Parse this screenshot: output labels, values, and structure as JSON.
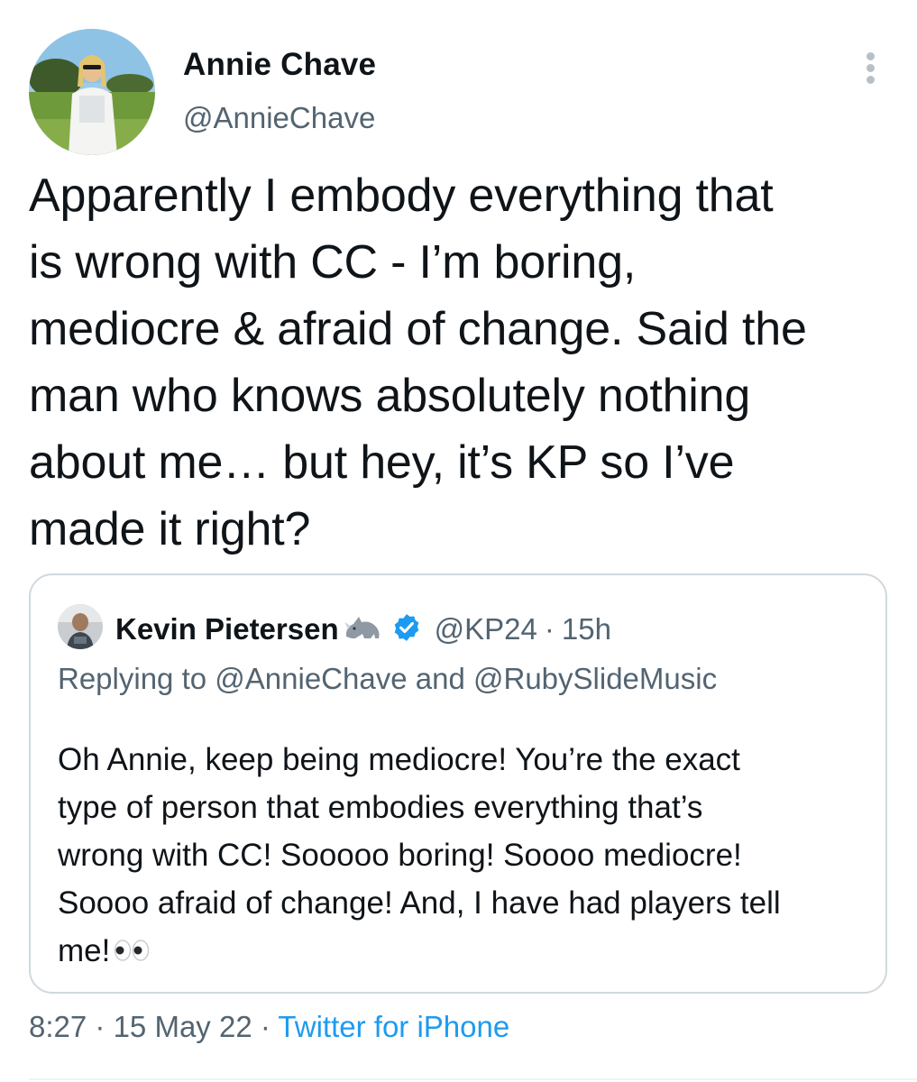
{
  "author": {
    "display_name": "Annie Chave",
    "handle": "@AnnieChave",
    "avatar_icon": "profile-photo"
  },
  "more_icon": "more-vertical-icon",
  "tweet_text": "Apparently I embody everything that\nis wrong with CC - I’m boring,\nmediocre & afraid of change. Said the\nman who knows absolutely nothing\nabout me… but hey, it’s KP so I’ve\nmade it right?",
  "quote": {
    "display_name": "Kevin Pietersen",
    "name_emoji": "rhino-icon",
    "verified_icon": "verified-badge-icon",
    "handle": "@KP24",
    "separator": "·",
    "time": "15h",
    "replying_prefix": "Replying to",
    "replying_mention_1": "@AnnieChave",
    "replying_and": "and",
    "replying_mention_2": "@RubySlideMusic",
    "text": "Oh Annie, keep being mediocre! You’re the exact\ntype of person that embodies everything that’s\nwrong with CC! Sooooo boring! Soooo mediocre!\nSoooo afraid of change! And, I have had players tell\nme!",
    "trailing_emoji": "eyes-icon"
  },
  "meta": {
    "time": "8:27",
    "separator": "·",
    "date": "15 May 22",
    "source": "Twitter for iPhone"
  },
  "colors": {
    "text": "#0f1419",
    "secondary": "#536471",
    "link": "#1d9bf0",
    "verified": "#1d9bf0",
    "border": "#cfd9de"
  }
}
